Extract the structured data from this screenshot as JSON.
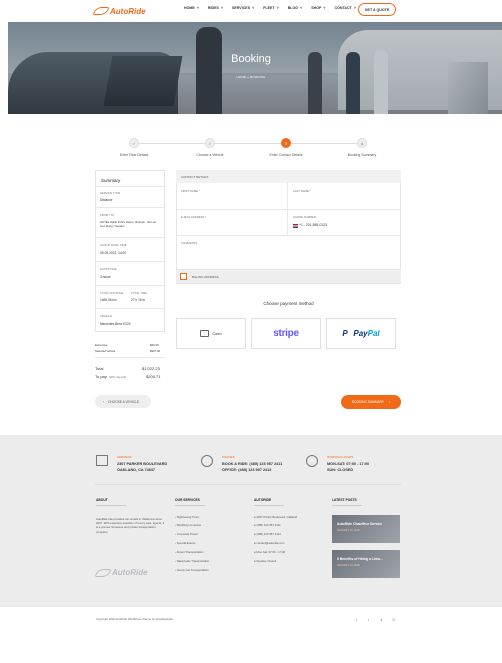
{
  "header": {
    "logo_text": "AutoRide",
    "nav": [
      "HOME",
      "RIDES",
      "SERVICES",
      "FLEET",
      "BLOG",
      "SHOP",
      "CONTACT"
    ],
    "quote_label": "GET A QUOTE"
  },
  "hero": {
    "title": "Booking",
    "breadcrumb": "HOME  »  BOOKING"
  },
  "steps": [
    {
      "num": "✓",
      "label": "Enter Ride Details",
      "state": "done"
    },
    {
      "num": "✓",
      "label": "Choose a Vehicle",
      "state": "done"
    },
    {
      "num": "3",
      "label": "Enter Contact Details",
      "state": "active"
    },
    {
      "num": "4",
      "label": "Booking Summary",
      "state": "todo"
    }
  ],
  "summary": {
    "title": "Summary",
    "service_type_label": "SERVICE TYPE",
    "service_type": "Distance",
    "from_to_label": "FROM / TO",
    "from_to": "HOTEL Hacik KOvic Hanoi, Vietnam - 62 Luu Lien Dong, Vietnam",
    "pickup_label": "PICKUP DATE, TIME",
    "pickup": "09-09-2022, 14:00",
    "extra_label": "EXTRA TIME",
    "extra": "3 hours",
    "distance_label": "TOTAL DISTANCE",
    "distance": "1465.06 km",
    "time_label": "TOTAL TIME",
    "time": "27 h 19 m",
    "vehicle_label": "VEHICLE",
    "vehicle": "Mercedes-Benz E220",
    "lines": [
      {
        "label": "Extra time",
        "value": "$26.00"
      },
      {
        "label": "Selected vehicle",
        "value": "$967.00"
      }
    ],
    "total_label": "Total",
    "total": "$1,022.23",
    "topay_label": "To pay",
    "topay_note": "(20% deposit)",
    "topay": "$204.71"
  },
  "form": {
    "heading": "CONTACT DETAILS",
    "first_name_label": "FIRST NAME *",
    "last_name_label": "LAST NAME *",
    "email_label": "E-MAIL ADDRESS *",
    "phone_label": "PHONE NUMBER",
    "phone_value": "+1 - 201-555-0123",
    "comments_label": "COMMENTS",
    "billing_label": "BILLING ADDRESS"
  },
  "payment": {
    "title": "Choose payment method",
    "cash_label": "Cash",
    "stripe_label": "stripe",
    "paypal_pay": "Pay",
    "paypal_pal": "Pal"
  },
  "buttons": {
    "back": "CHOOSE A VEHICLE",
    "next": "BOOKING SUMMARY"
  },
  "footer": {
    "address_label": "ADDRESS",
    "address_value_1": "2307 PARKER BOULEVARD",
    "address_value_2": "OAKLAND, CA 74637",
    "phone_label": "PHONES",
    "phone_value_1": "BOOK A RIDE: (485) 123 957 2411",
    "phone_value_2": "OFFICE: (485) 123 957 2412",
    "hours_label": "WORKING HOURS",
    "hours_value_1": "MON-SAT: 07:00 - 17:00",
    "hours_value_2": "SUN: CLOSED",
    "about_title": "ABOUT",
    "about_text": "AutoRide has provided car rentals in Oklahoma since 2007. With extensive selection of luxury cars, agents, it is a premier limousine and private transportation company.",
    "services_title": "OUR SERVICES",
    "services": [
      "Sightseeing Tours",
      "Wedding Limousine",
      "Corporate Travel",
      "Special Events",
      "Airport Transportation",
      "Nationwide Transportation",
      "Hourly Car Transportation"
    ],
    "autoride_title": "AUTORIDE",
    "contacts": [
      "2307 Parker Boulevard, Oakland",
      "(485) 123 957 2411",
      "(485) 123 957 2412",
      "contact@autoride.com",
      "Mon-Sat: 07:00 - 17:00",
      "Sunday: Closed"
    ],
    "posts_title": "LATEST POSTS",
    "posts": [
      {
        "title": "AutoRide Chauffeur Service",
        "date": "JANUARY 14, 2020"
      },
      {
        "title": "5 Benefits of Hiring a Limo...",
        "date": "JANUARY 14, 2020"
      }
    ],
    "logo_text": "AutoRide",
    "copyright": "Copyright 2020 AutoRide WordPress Theme by QuanticaLabs"
  }
}
